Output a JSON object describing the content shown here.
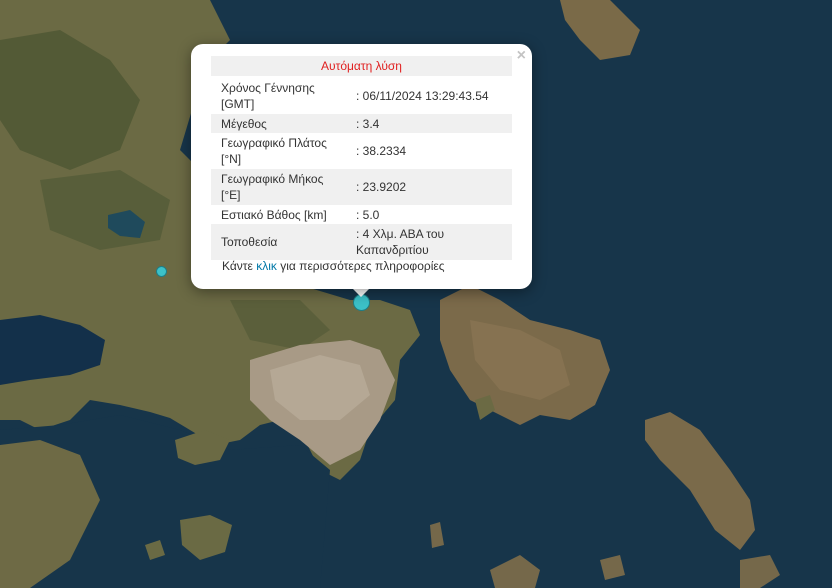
{
  "popup": {
    "title": "Αυτόματη λύση",
    "close": "×",
    "rows": [
      {
        "label": "Χρόνος Γέννησης [GMT]",
        "value": ": 06/11/2024 13:29:43.54"
      },
      {
        "label": "Μέγεθος",
        "value": ": 3.4"
      },
      {
        "label": "Γεωγραφικό Πλάτος [°N]",
        "value": ": 38.2334"
      },
      {
        "label": "Γεωγραφικό Μήκος [°E]",
        "value": ": 23.9202"
      },
      {
        "label": "Εστιακό Βάθος [km]",
        "value": ": 5.0"
      },
      {
        "label": "Τοποθεσία",
        "value": ": 4 Χλμ. ΑΒΑ του Καπανδριτίου"
      }
    ],
    "footer": {
      "before": "Κάντε ",
      "link": "κλικ",
      "after": " για περισσότερες πληροφορίες"
    }
  },
  "colors": {
    "sea": "#17354a",
    "land": "#6b6a44",
    "marker": "#3cc1c8",
    "title_text": "#e02020",
    "link": "#0078a8"
  }
}
